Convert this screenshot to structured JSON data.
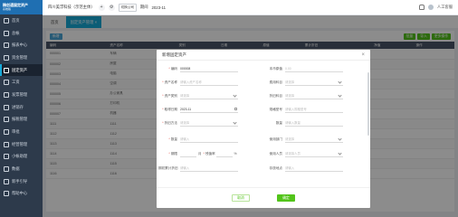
{
  "app": {
    "name": "精创通固定资产",
    "sub": "系统版"
  },
  "sidebar": {
    "items": [
      {
        "label": "首页"
      },
      {
        "label": "总帐"
      },
      {
        "label": "报表中心"
      },
      {
        "label": "资金管理"
      },
      {
        "label": "固定资产"
      },
      {
        "label": "工资"
      },
      {
        "label": "发票管理"
      },
      {
        "label": "进销存"
      },
      {
        "label": "报税管理"
      },
      {
        "label": "审批"
      },
      {
        "label": "经营管理"
      },
      {
        "label": "小帐助理"
      },
      {
        "label": "数据"
      },
      {
        "label": "新手引导"
      },
      {
        "label": "帮助中心"
      }
    ],
    "active_index": 4
  },
  "topbar": {
    "company": "四川美浮科技（示范主体）",
    "chip": "切换公司",
    "period_label": "期间",
    "period": "2023-11",
    "user": "人工客服"
  },
  "tabs": [
    {
      "label": "首页"
    },
    {
      "label": "固定资产管理 ×"
    }
  ],
  "background": {
    "add_btn": "新增",
    "right_btns": [
      "批量",
      "导入",
      "更多操作"
    ],
    "columns": [
      "编码",
      "资产名称",
      "类别",
      "日期",
      "原值",
      "累计折旧",
      "净值",
      "操作"
    ],
    "rows": [
      [
        "000001",
        "车辆",
        "车辆",
        "",
        "",
        "",
        "",
        ""
      ],
      [
        "000002",
        "房屋",
        "",
        "",
        "",
        "",
        "",
        ""
      ],
      [
        "000003",
        "电脑",
        "",
        "",
        "",
        "",
        "",
        ""
      ],
      [
        "000004",
        "空调",
        "",
        "",
        "",
        "",
        "",
        ""
      ],
      [
        "000005",
        "办公家具",
        "",
        "",
        "",
        "",
        "",
        ""
      ],
      [
        "000006",
        "打印机",
        "",
        "",
        "",
        "",
        "",
        ""
      ],
      [
        "000007",
        "机器",
        "",
        "",
        "",
        "",
        "",
        ""
      ],
      [
        "1111",
        "1111",
        "",
        "",
        "",
        "",
        "",
        ""
      ],
      [
        "1112",
        "1112",
        "",
        "",
        "",
        "",
        "",
        ""
      ],
      [
        "1113",
        "1113",
        "",
        "",
        "",
        "",
        "",
        ""
      ],
      [
        "1114",
        "1114",
        "",
        "",
        "",
        "",
        "",
        ""
      ],
      [
        "1115",
        "1115",
        "",
        "",
        "",
        "",
        "",
        ""
      ],
      [
        "1116",
        "1116",
        "",
        "",
        "",
        "",
        "",
        ""
      ]
    ]
  },
  "modal": {
    "title": "新增固定资产",
    "fields": {
      "code": {
        "label": "编码",
        "value": "000008"
      },
      "name": {
        "label": "资产名称",
        "placeholder": "请输入资产名称"
      },
      "category": {
        "label": "资产类别",
        "placeholder": "请选择"
      },
      "date": {
        "label": "取得日期",
        "value": "2023-11"
      },
      "method": {
        "label": "折旧方法",
        "placeholder": "请选择"
      },
      "qty": {
        "label": "数量",
        "placeholder": "请输入"
      },
      "life": {
        "label": "期限",
        "unit": "月"
      },
      "salvage": {
        "label": "残值率",
        "unit": "%"
      },
      "prev_depr": {
        "label": "期初累计折旧",
        "placeholder": "请输入"
      },
      "origin": {
        "label": "本币原值",
        "placeholder": "0.00"
      },
      "account": {
        "label": "费用科目",
        "placeholder": "请选择"
      },
      "depr_account": {
        "label": "折旧科目",
        "placeholder": "请选择"
      },
      "spec": {
        "label": "规格型号",
        "placeholder": "请输入规格型号"
      },
      "unit_count": {
        "label": "数量",
        "placeholder": "请输入数量"
      },
      "dept": {
        "label": "使用部门",
        "placeholder": "请选择"
      },
      "user": {
        "label": "使用人员",
        "placeholder": "请选择人员"
      },
      "location": {
        "label": "存放地点",
        "placeholder": "请输入"
      }
    },
    "cancel": "取消",
    "ok": "确定"
  },
  "colors": {
    "accent": "#16a9d8",
    "primary": "#52c41a",
    "sidebar": "#2d3a4b"
  }
}
